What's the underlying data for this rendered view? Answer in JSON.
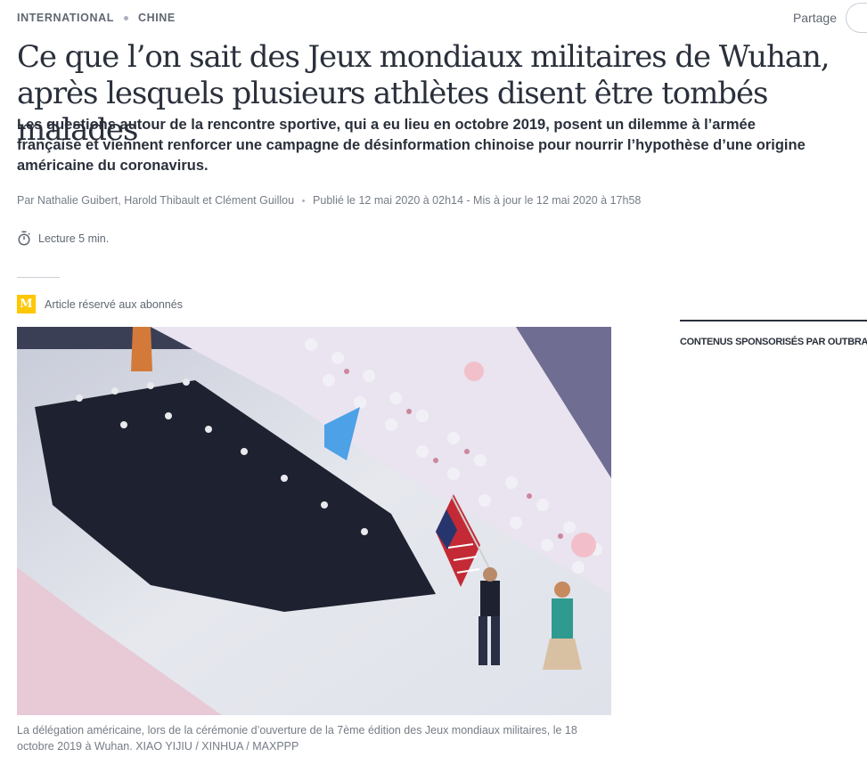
{
  "breadcrumb": {
    "section": "INTERNATIONAL",
    "subsection": "CHINE"
  },
  "share": {
    "label": "Partage"
  },
  "article": {
    "title": "Ce que l’on sait des Jeux mondiaux militaires de Wuhan, après lesquels plusieurs athlètes disent être tombés malades",
    "description": "Les questions autour de la rencontre sportive, qui a eu lieu en octobre 2019, posent un dilemme à l’armée française et viennent renforcer une campagne de désinformation chinoise pour nourrir l’hypothèse d’une origine américaine du coronavirus.",
    "authors": "Par Nathalie Guibert, Harold Thibault et Clément Guillou",
    "published": "Publié le 12 mai 2020 à 02h14 - Mis à jour le 12 mai 2020 à 17h58",
    "reading_time": "Lecture 5 min.",
    "premium_icon_letter": "M",
    "premium_label": "Article réservé aux abonnés",
    "caption": "La délégation américaine, lors de la cérémonie d’ouverture de la 7ème édition des Jeux mondiaux militaires, le 18 octobre 2019 à Wuhan. XIAO YIJIU / XINHUA / MAXPPP"
  },
  "sidebar": {
    "sponsored_label": "CONTENUS SPONSORISÉS PAR",
    "sponsor_name": "OUTBRAIN",
    "separator": "|"
  },
  "colors": {
    "text": "#2a303b",
    "muted": "#757c86",
    "premium_yellow": "#ffc700"
  }
}
